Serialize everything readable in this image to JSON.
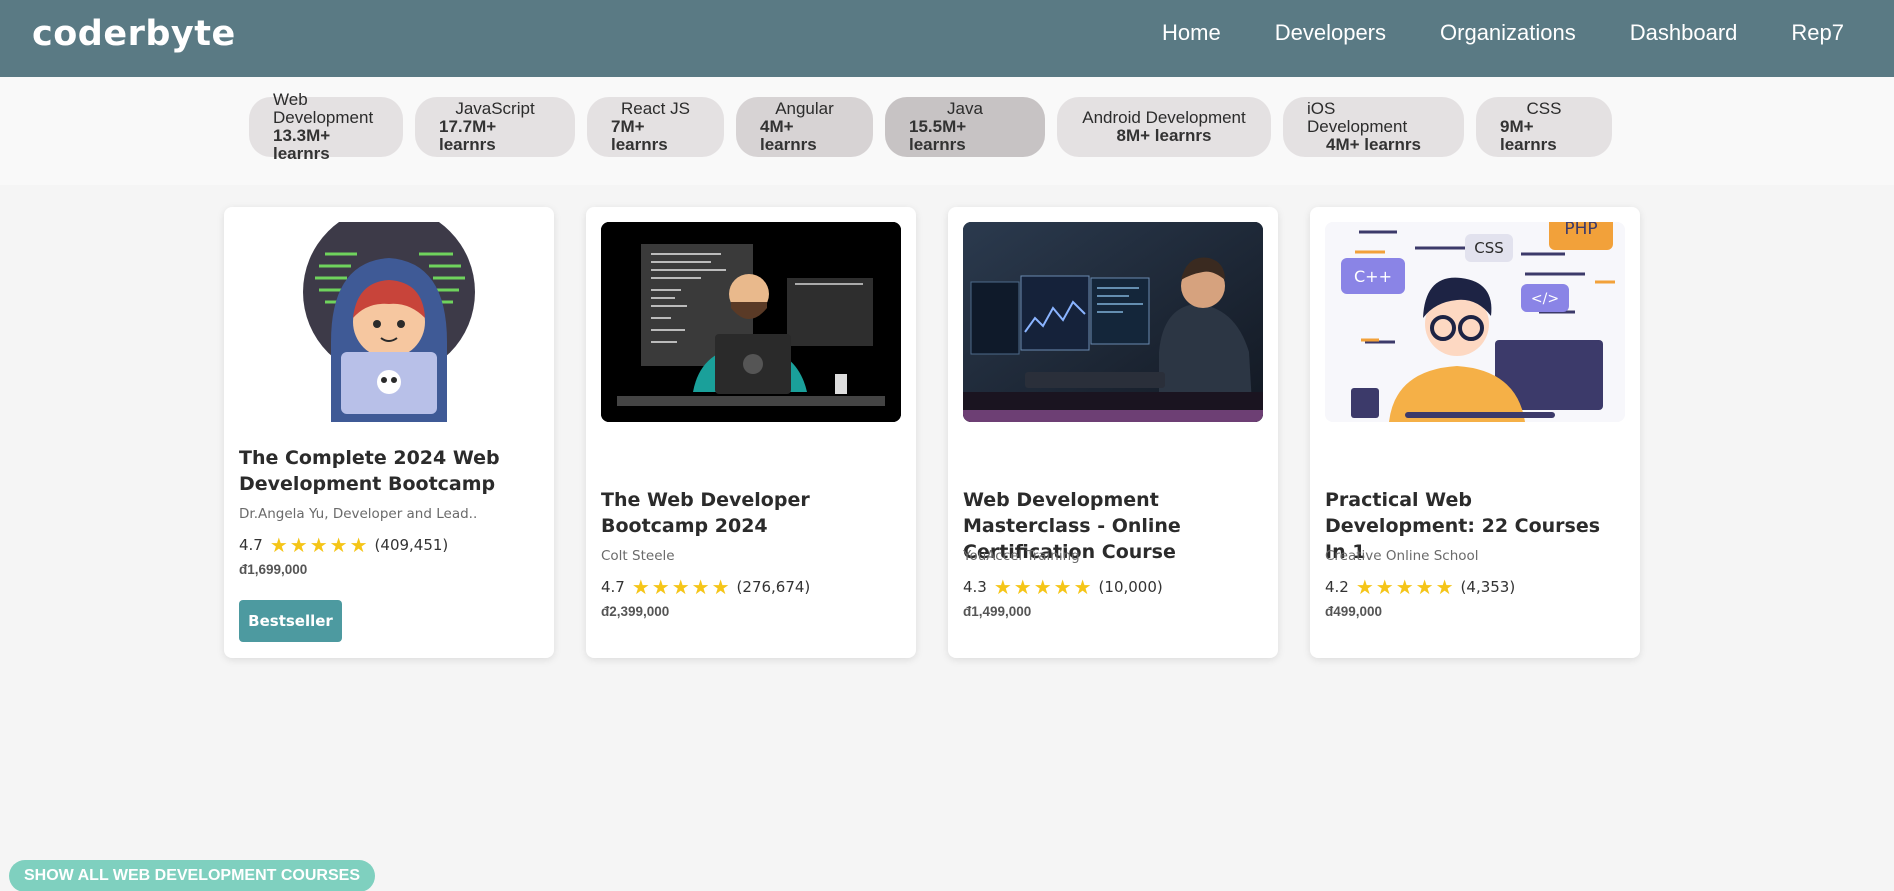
{
  "header": {
    "logo": "coderbyte",
    "nav": [
      "Home",
      "Developers",
      "Organizations",
      "Dashboard",
      "Rep7"
    ]
  },
  "categories": [
    {
      "name": "Web Development",
      "learners": "13.3M+ learnrs"
    },
    {
      "name": "JavaScript",
      "learners": "17.7M+ learnrs"
    },
    {
      "name": "React JS",
      "learners": "7M+ learnrs"
    },
    {
      "name": "Angular",
      "learners": "4M+ learnrs"
    },
    {
      "name": "Java",
      "learners": "15.5M+ learnrs"
    },
    {
      "name": "Android Development",
      "learners": "8M+ learnrs"
    },
    {
      "name": "iOS Development",
      "learners": "4M+ learnrs"
    },
    {
      "name": "CSS",
      "learners": "9M+ learnrs"
    }
  ],
  "courses": [
    {
      "title": "The Complete 2024 Web Development Bootcamp",
      "author": "Dr.Angela Yu, Developer and Lead..",
      "rating": "4.7",
      "reviews": "(409,451)",
      "price": "đ1,699,000",
      "badge": "Bestseller",
      "image": "hacker-illustration"
    },
    {
      "title": "The Web Developer Bootcamp 2024",
      "author": "Colt Steele",
      "rating": "4.7",
      "reviews": "(276,674)",
      "price": "đ2,399,000",
      "image": "instructor-laptop-photo"
    },
    {
      "title": "Web Development Masterclass - Online Certification Course",
      "author": "YouAccel Training",
      "rating": "4.3",
      "reviews": "(10,000)",
      "price": "đ1,499,000",
      "image": "developer-monitors-photo"
    },
    {
      "title": "Practical Web Development: 22 Courses In 1",
      "author": "Creative Online School",
      "rating": "4.2",
      "reviews": "(4,353)",
      "price": "đ499,000",
      "image": "programmer-languages-illustration",
      "image_text": [
        "PHP",
        "CSS",
        "C++",
        "</>"
      ]
    }
  ],
  "show_all": "SHOW ALL WEB DEVELOPMENT COURSES",
  "colors": {
    "header": "#5a7a84",
    "badge": "#4d9aa0",
    "star": "#f5c518",
    "show_all": "#7fd0bf"
  }
}
